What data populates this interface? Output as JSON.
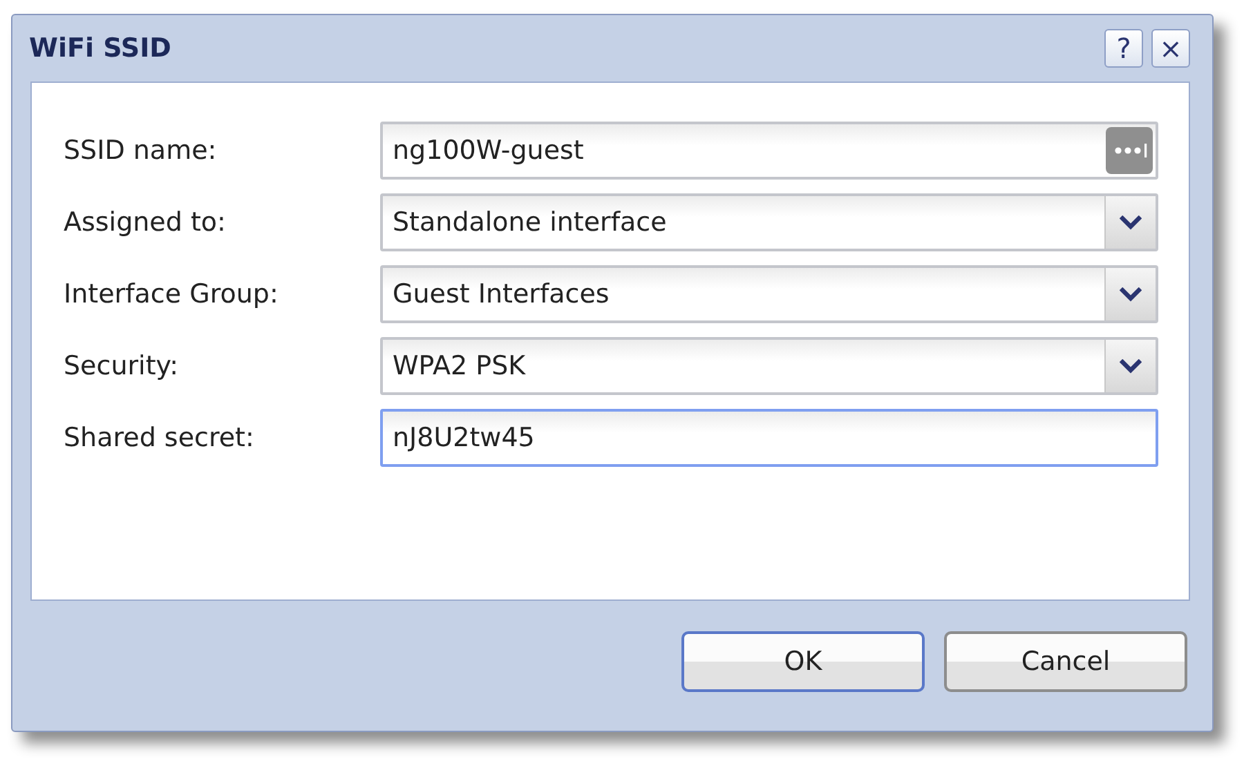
{
  "window": {
    "title": "WiFi SSID",
    "help_button": "?",
    "close_button": "×"
  },
  "fields": [
    {
      "label": "SSID name:",
      "kind": "text-more",
      "value": "ng100W-guest",
      "focused": false
    },
    {
      "label": "Assigned to:",
      "kind": "select",
      "value": "Standalone interface",
      "focused": false
    },
    {
      "label": "Interface Group:",
      "kind": "select",
      "value": "Guest Interfaces",
      "focused": false
    },
    {
      "label": "Security:",
      "kind": "select",
      "value": "WPA2 PSK",
      "focused": false
    },
    {
      "label": "Shared secret:",
      "kind": "text",
      "value": "nJ8U2tw45",
      "focused": true
    }
  ],
  "buttons": [
    {
      "label": "OK",
      "default": true
    },
    {
      "label": "Cancel",
      "default": false
    }
  ]
}
